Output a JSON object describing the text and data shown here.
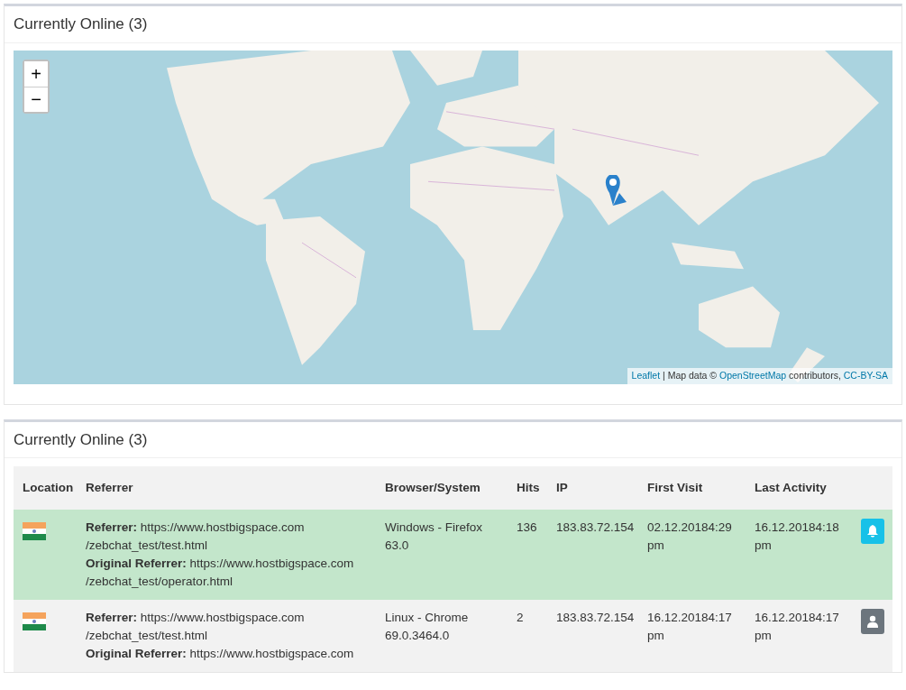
{
  "map_panel": {
    "title": "Currently Online (3)",
    "zoom_in": "+",
    "zoom_out": "−",
    "attribution": [
      {
        "text": "Leaflet",
        "link": true
      },
      {
        "text": " | Map data © ",
        "link": false
      },
      {
        "text": "OpenStreetMap",
        "link": true
      },
      {
        "text": " contributors, ",
        "link": false
      },
      {
        "text": "CC-BY-SA",
        "link": true
      }
    ]
  },
  "table_panel": {
    "title": "Currently Online (3)",
    "columns": [
      "Location",
      "Referrer",
      "Browser/System",
      "Hits",
      "IP",
      "First Visit",
      "Last Activity"
    ],
    "rows": [
      {
        "highlighted": true,
        "referrer": "**Referrer:** https://www.hostbigspace.com/zebchat_test/test.html",
        "original_referrer": "**Original Referrer:** https://www.hostbigspace.com/zebchat_test/operator.html",
        "browser": "Windows - Firefox 63.0",
        "hits": "136",
        "ip": "183.83.72.154",
        "first_visit": "02.12.20184:29 pm",
        "last_activity": "16.12.20184:18 pm",
        "kind": "bell"
      },
      {
        "highlighted": false,
        "referrer": "**Referrer:** https://www.hostbigspace.com/zebchat_test/test.html",
        "original_referrer": "**Original Referrer:** https://www.hostbigspace.com",
        "browser": "Linux - Chrome 69.0.3464.0",
        "hits": "2",
        "ip": "183.83.72.154",
        "first_visit": "16.12.20184:17 pm",
        "last_activity": "16.12.20184:17 pm",
        "kind": "user"
      }
    ]
  }
}
